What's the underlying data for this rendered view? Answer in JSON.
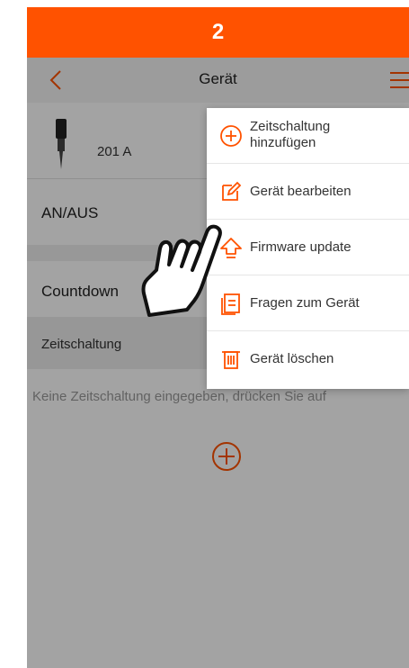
{
  "step": {
    "number": "2"
  },
  "app_bar": {
    "title": "Gerät",
    "back_icon": "chevron-left-icon",
    "menu_icon": "hamburger-menu-icon"
  },
  "device": {
    "name": "201 A",
    "icon": "probe-icon"
  },
  "rows": {
    "onoff": "AN/AUS",
    "countdown": "Countdown"
  },
  "section": {
    "schedule_header": "Zeitschaltung"
  },
  "empty_state": {
    "text": "Keine Zeitschaltung eingegeben, drücken Sie auf"
  },
  "popup_menu": {
    "items": [
      {
        "label_line1": "Zeitschaltung",
        "label_line2": "hinzufügen",
        "icon": "plus-circle-icon"
      },
      {
        "label": "Gerät bearbeiten",
        "icon": "edit-icon"
      },
      {
        "label": "Firmware update",
        "icon": "upload-arrow-icon"
      },
      {
        "label": "Fragen zum Gerät",
        "icon": "document-icon"
      },
      {
        "label": "Gerät löschen",
        "icon": "trash-icon"
      }
    ]
  },
  "colors": {
    "accent": "#ff5200",
    "overlay": "rgba(0,0,0,0.36)"
  }
}
